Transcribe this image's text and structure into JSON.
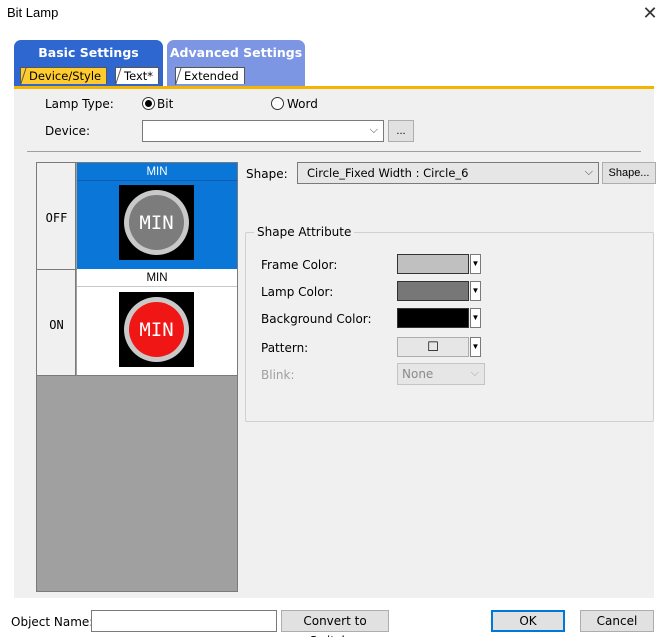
{
  "window": {
    "title": "Bit Lamp"
  },
  "tabs": {
    "basic": {
      "label": "Basic Settings",
      "subtabs": [
        "Device/Style",
        "Text*"
      ]
    },
    "advanced": {
      "label": "Advanced Settings",
      "subtabs": [
        "Extended"
      ]
    }
  },
  "lamp_type": {
    "label": "Lamp Type:",
    "options": [
      "Bit",
      "Word"
    ],
    "selected": "Bit"
  },
  "device": {
    "label": "Device:",
    "value": "",
    "browse_label": "..."
  },
  "states": {
    "off": {
      "label": "OFF",
      "caption": "MIN",
      "lamp_text": "MIN"
    },
    "on": {
      "label": "ON",
      "caption": "MIN",
      "lamp_text": "MIN"
    }
  },
  "shape": {
    "label": "Shape:",
    "value": "Circle_Fixed Width : Circle_6",
    "button_label": "Shape..."
  },
  "shape_attribute": {
    "title": "Shape Attribute",
    "frame_color": {
      "label": "Frame Color:",
      "color": "#c0c0c0"
    },
    "lamp_color": {
      "label": "Lamp Color:",
      "color": "#777777"
    },
    "background_color": {
      "label": "Background Color:",
      "color": "#000000"
    },
    "pattern": {
      "label": "Pattern:",
      "glyph": "☐"
    },
    "blink": {
      "label": "Blink:",
      "value": "None"
    }
  },
  "footer": {
    "object_name_label": "Object Name:",
    "object_name_value": "",
    "convert_label": "Convert to Switch...",
    "ok_label": "OK",
    "cancel_label": "Cancel"
  },
  "colors": {
    "accent_tab": "#2f67d1",
    "active_subtab": "#ffcb2e",
    "selected_state": "#0a76d7",
    "lamp_on": "#f01616",
    "lamp_off": "#7c7c7c"
  }
}
